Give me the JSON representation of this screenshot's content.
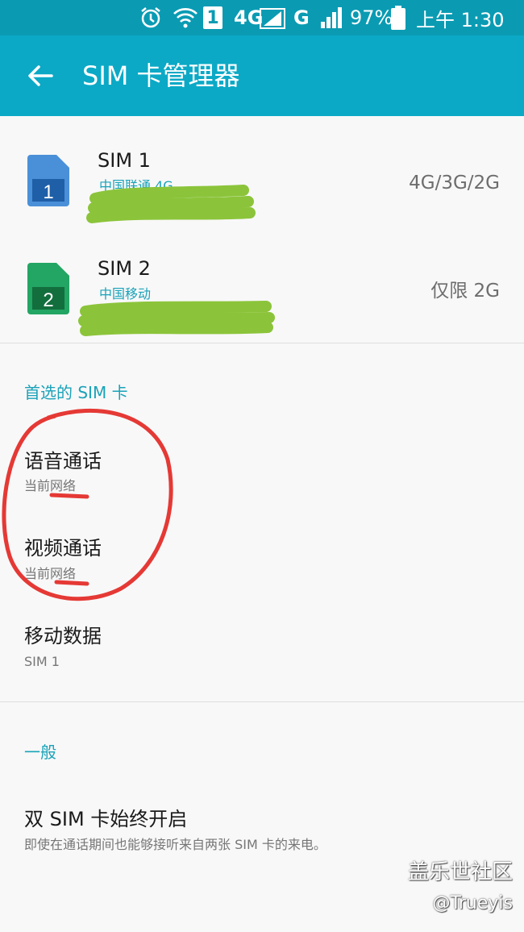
{
  "status_bar": {
    "net1": "4G",
    "net2": "G",
    "sim_slot": "1",
    "battery": "97%",
    "time": "上午 1:30"
  },
  "header": {
    "title": "SIM 卡管理器"
  },
  "sims": [
    {
      "name": "SIM 1",
      "carrier": "中国联通 4G",
      "network": "4G/3G/2G",
      "slot": "1",
      "color": "#3d86cf"
    },
    {
      "name": "SIM 2",
      "carrier": "中国移动",
      "network": "仅限 2G",
      "slot": "2",
      "color": "#1e9c5a"
    }
  ],
  "preferred": {
    "header": "首选的 SIM 卡",
    "items": [
      {
        "title": "语音通话",
        "subtitle": "当前网络"
      },
      {
        "title": "视频通话",
        "subtitle": "当前网络"
      },
      {
        "title": "移动数据",
        "subtitle": "SIM 1"
      }
    ]
  },
  "general": {
    "header": "一般",
    "items": [
      {
        "title": "双 SIM 卡始终开启",
        "subtitle": "即使在通话期间也能够接听来自两张 SIM 卡的来电。"
      }
    ]
  },
  "watermark": {
    "line1": "盖乐世社区",
    "line2": "@Trueyis"
  },
  "colors": {
    "status_bar": "#0a9bb3",
    "app_bar": "#0ba9c6",
    "accent": "#1aa2b8",
    "scribble_green": "#8bc43a",
    "annotation_red": "#e53935"
  }
}
